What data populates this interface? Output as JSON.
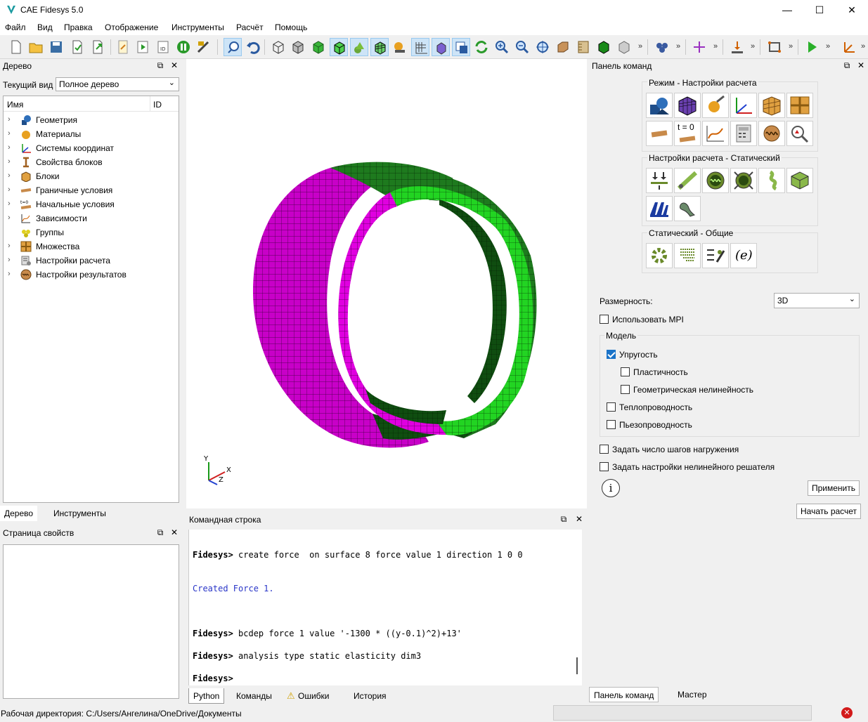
{
  "app": {
    "title": "CAE Fidesys 5.0"
  },
  "menu": [
    "Файл",
    "Вид",
    "Правка",
    "Отображение",
    "Инструменты",
    "Расчёт",
    "Помощь"
  ],
  "tree_panel": {
    "title": "Дерево",
    "view_label": "Текущий вид",
    "view_value": "Полное дерево",
    "col_name": "Имя",
    "col_id": "ID",
    "items": [
      {
        "label": "Геометрия",
        "icon": "geometry-icon"
      },
      {
        "label": "Материалы",
        "icon": "materials-icon"
      },
      {
        "label": "Системы координат",
        "icon": "coordinate-systems-icon"
      },
      {
        "label": "Свойства блоков",
        "icon": "block-properties-icon"
      },
      {
        "label": "Блоки",
        "icon": "blocks-icon"
      },
      {
        "label": "Граничные условия",
        "icon": "boundary-conditions-icon"
      },
      {
        "label": "Начальные условия",
        "icon": "initial-conditions-icon"
      },
      {
        "label": "Зависимости",
        "icon": "dependencies-icon"
      },
      {
        "label": "Группы",
        "icon": "groups-icon"
      },
      {
        "label": "Множества",
        "icon": "sets-icon"
      },
      {
        "label": "Настройки расчета",
        "icon": "analysis-settings-icon"
      },
      {
        "label": "Настройки результатов",
        "icon": "results-settings-icon"
      }
    ],
    "tabs": [
      "Дерево",
      "Инструменты"
    ]
  },
  "props_panel": {
    "title": "Страница свойств"
  },
  "command_line": {
    "title": "Командная строка",
    "lines": [
      "Fidesys> create force  on surface 8 force value 1 direction 1 0 0",
      "Created Force 1.",
      "Fidesys> bcdep force 1 value '-1300 * ((y-0.1)^2)+13'",
      "Fidesys> analysis type static elasticity dim3",
      "Fidesys>"
    ],
    "tabs": [
      "Python",
      "Команды",
      "Ошибки",
      "История"
    ]
  },
  "command_panel": {
    "title": "Панель команд",
    "group1": "Режим - Настройки расчета",
    "group2": "Настройки расчета - Статический",
    "group3": "Статический - Общие",
    "t0_label": "t = 0",
    "e_label": "(e)",
    "dimension_label": "Размерность:",
    "dimension_value": "3D",
    "use_mpi": "Использовать MPI",
    "model_label": "Модель",
    "elasticity": "Упругость",
    "plasticity": "Пластичность",
    "geom_nonlinear": "Геометрическая нелинейность",
    "heat": "Теплопроводность",
    "piezo": "Пьезопроводность",
    "load_steps": "Задать число шагов нагружения",
    "nonlinear_solver": "Задать настройки нелинейного решателя",
    "apply": "Применить",
    "start": "Начать расчет",
    "tabs": [
      "Панель команд",
      "Мастер"
    ]
  },
  "axes": {
    "x": "X",
    "y": "Y",
    "z": "Z"
  },
  "status": {
    "workdir": "Рабочая директория: C:/Users/Ангелина/OneDrive/Документы"
  },
  "colors": {
    "magenta": "#cc00cc",
    "green": "#1ea91e",
    "dark_green": "#0c5a0c"
  }
}
